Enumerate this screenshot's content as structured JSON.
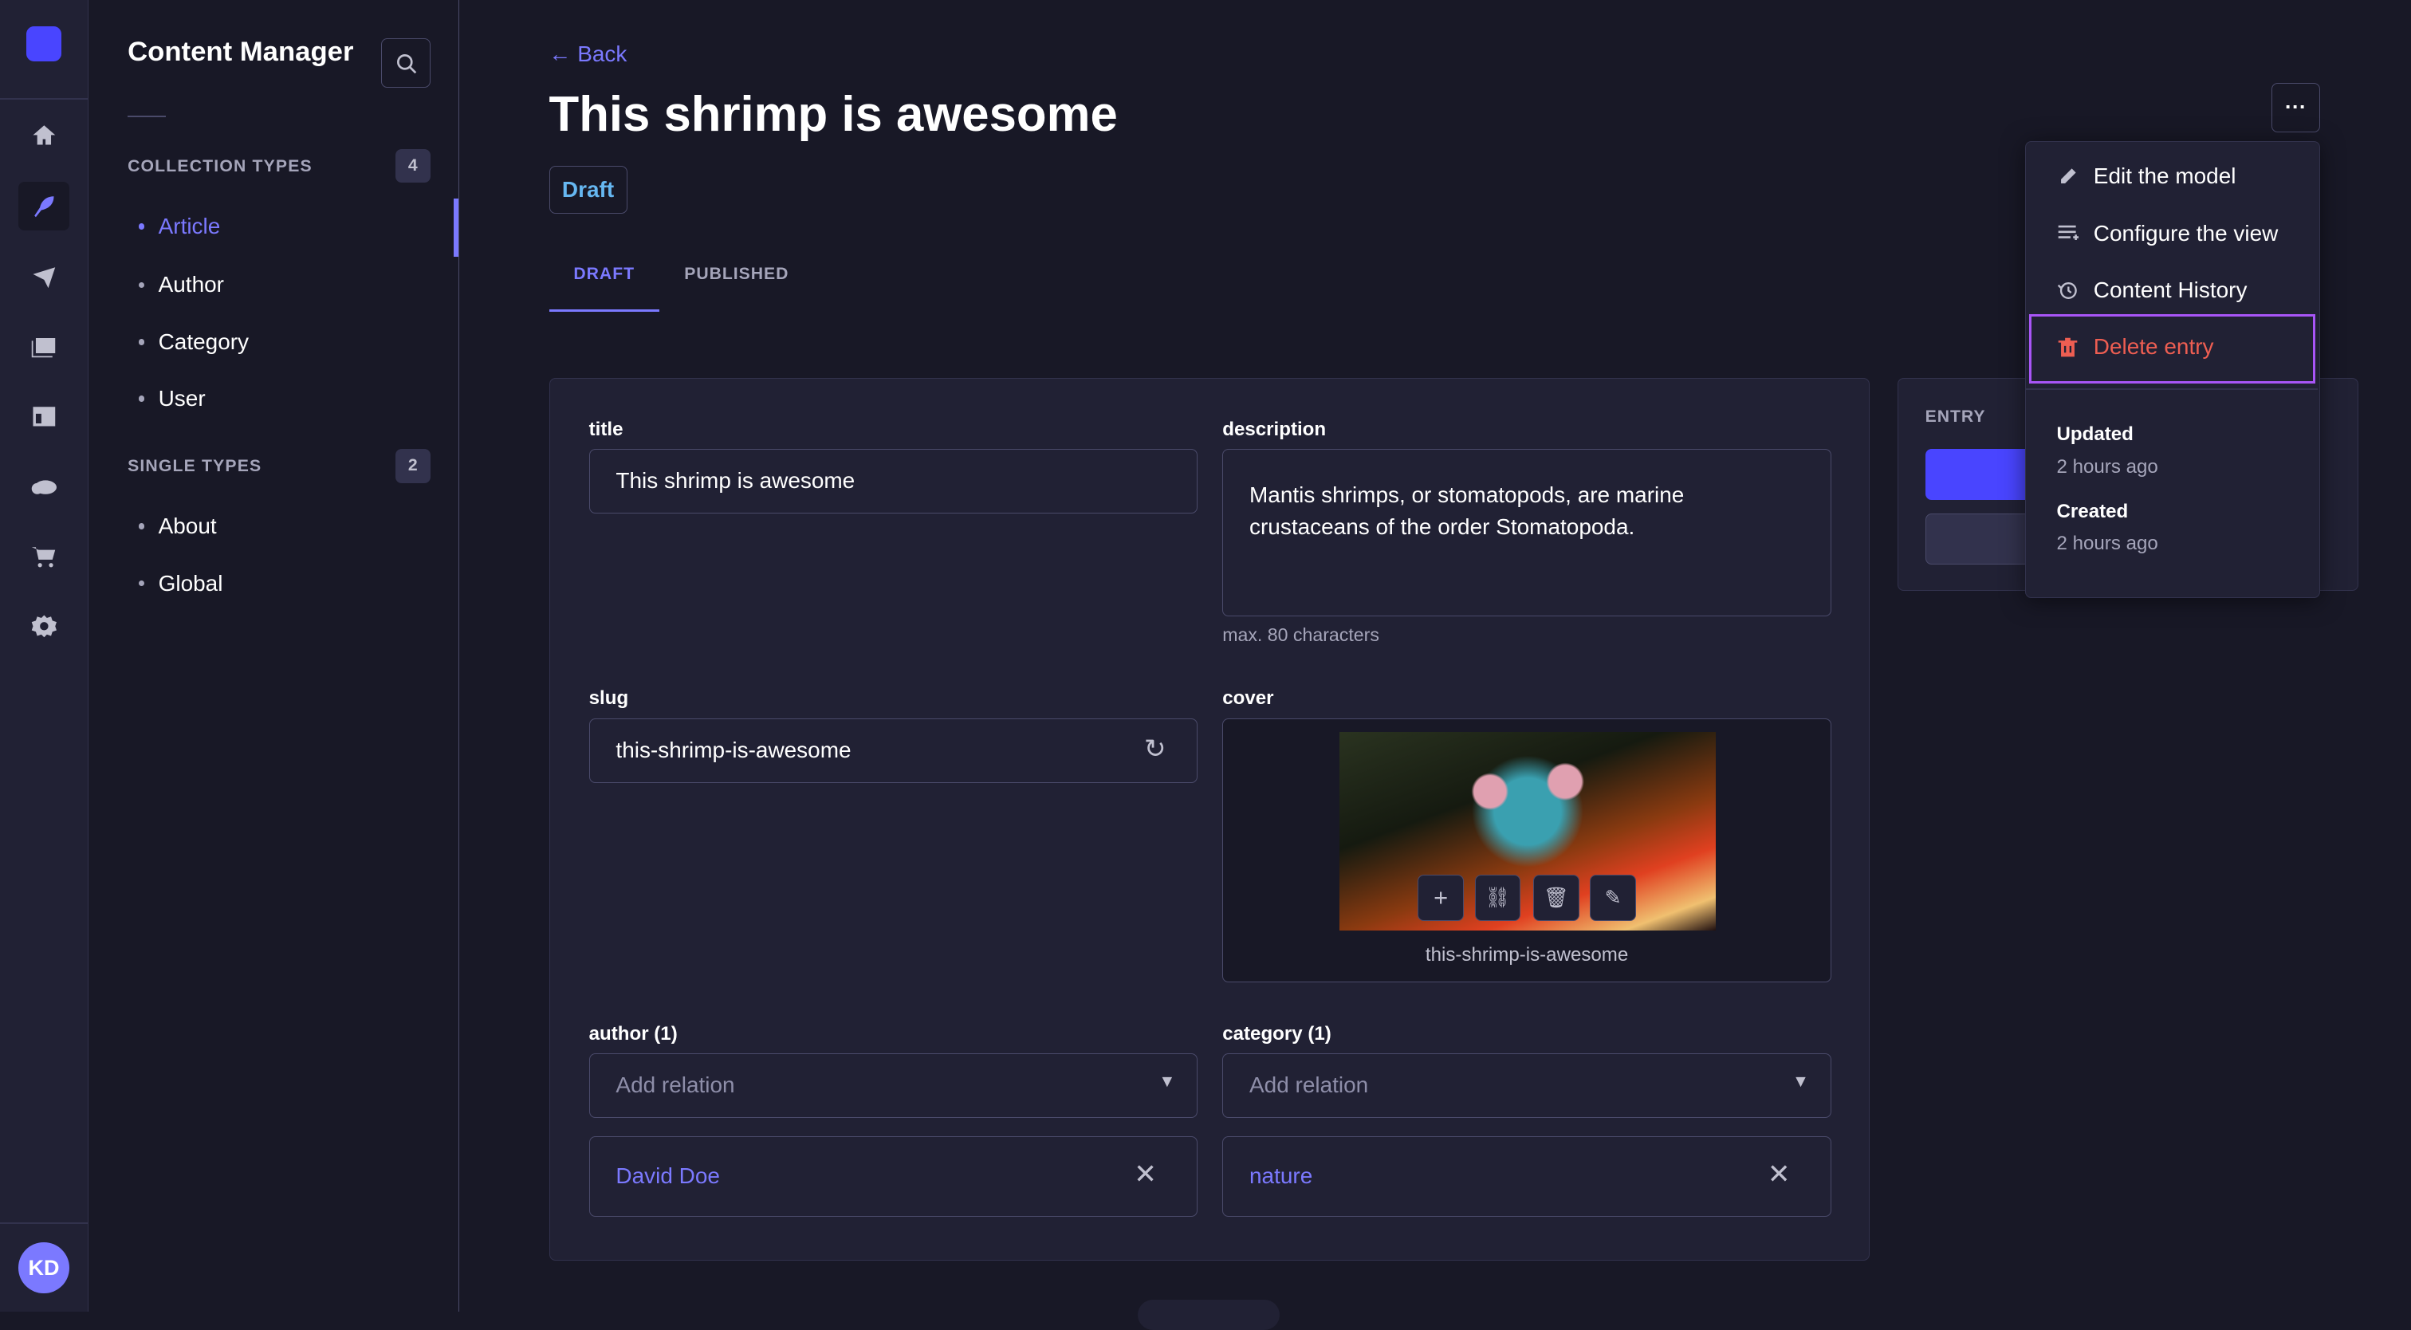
{
  "nav": {
    "items": [
      "logo",
      "home-icon",
      "content-manager-icon",
      "releases-icon",
      "media-library-icon",
      "content-type-builder-icon",
      "cloud-icon",
      "marketplace-icon",
      "settings-icon"
    ],
    "avatar": "KD"
  },
  "sidebar": {
    "title": "Content Manager",
    "collection_types": {
      "label": "COLLECTION TYPES",
      "count": "4",
      "items": [
        "Article",
        "Author",
        "Category",
        "User"
      ],
      "active": "Article"
    },
    "single_types": {
      "label": "SINGLE TYPES",
      "count": "2",
      "items": [
        "About",
        "Global"
      ]
    }
  },
  "header": {
    "back": "Back",
    "title": "This shrimp is awesome",
    "status": "Draft",
    "tabs": [
      "DRAFT",
      "PUBLISHED"
    ],
    "active_tab": "DRAFT",
    "more": "···"
  },
  "form": {
    "title": {
      "label": "title",
      "value": "This shrimp is awesome"
    },
    "description": {
      "label": "description",
      "value": "Mantis shrimps, or stomatopods, are marine crustaceans of the order Stomatopoda.",
      "hint": "max. 80 characters"
    },
    "slug": {
      "label": "slug",
      "value": "this-shrimp-is-awesome"
    },
    "cover": {
      "label": "cover",
      "caption": "this-shrimp-is-awesome"
    },
    "author": {
      "label": "author (1)",
      "placeholder": "Add relation",
      "item": "David Doe"
    },
    "category": {
      "label": "category (1)",
      "placeholder": "Add relation",
      "item": "nature"
    }
  },
  "entry": {
    "label": "ENTRY"
  },
  "menu": {
    "items": [
      "Edit the model",
      "Configure the view",
      "Content History",
      "Delete entry"
    ],
    "updated_label": "Updated",
    "updated_value": "2 hours ago",
    "created_label": "Created",
    "created_value": "2 hours ago"
  },
  "colors": {
    "accent": "#7b79ff",
    "primary": "#4945ff",
    "danger": "#ee5e52",
    "highlight": "#a855f7",
    "draft": "#66b7f1"
  }
}
